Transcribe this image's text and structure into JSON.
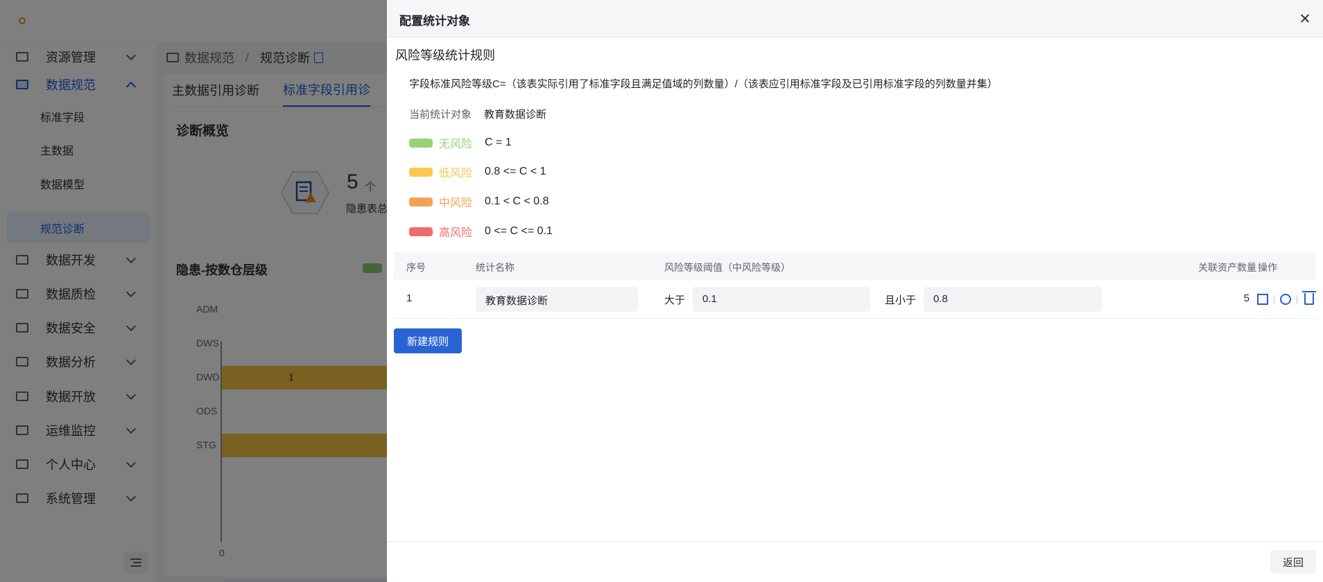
{
  "sidebar": {
    "items": [
      {
        "label": "资源管理",
        "icon": "resource-icon"
      },
      {
        "label": "数据规范",
        "icon": "standard-icon",
        "open": true
      },
      {
        "label": "数据开发",
        "icon": "dev-icon"
      },
      {
        "label": "数据质检",
        "icon": "quality-icon"
      },
      {
        "label": "数据安全",
        "icon": "security-icon"
      },
      {
        "label": "数据分析",
        "icon": "analysis-icon"
      },
      {
        "label": "数据开放",
        "icon": "open-icon"
      },
      {
        "label": "运维监控",
        "icon": "monitor-icon"
      },
      {
        "label": "个人中心",
        "icon": "user-icon"
      },
      {
        "label": "系统管理",
        "icon": "system-icon"
      }
    ],
    "sub_items": [
      "标准字段",
      "主数据",
      "数据模型",
      "规范诊断"
    ]
  },
  "breadcrumb": {
    "parent": "数据规范",
    "current": "规范诊断"
  },
  "tabs": [
    "主数据引用诊断",
    "标准字段引用诊"
  ],
  "overview": {
    "title": "诊断概览",
    "count": "5",
    "unit": "个",
    "label": "隐患表总"
  },
  "chart_section": {
    "title": "隐患-按数仓层级"
  },
  "chart_data": {
    "type": "bar",
    "orientation": "horizontal",
    "categories": [
      "ADM",
      "DWS",
      "DWD",
      "ODS",
      "STG"
    ],
    "values": [
      null,
      null,
      1,
      null,
      null
    ],
    "value_labels": [
      "",
      "",
      "1",
      "",
      ""
    ],
    "x_tick_zero": "0"
  },
  "drawer": {
    "title": "配置统计对象",
    "rule_title": "风险等级统计规则",
    "formula": "字段标准风险等级C=（该表实际引用了标准字段且满足值域的列数量）/（该表应引用标准字段及已引用标准字段的列数量并集）",
    "current_label": "当前统计对象",
    "current_value": "教育数据诊断",
    "levels": [
      {
        "name": "无风险",
        "cond": "C = 1",
        "color": "#95d475"
      },
      {
        "name": "低风险",
        "cond": "0.8 <= C < 1",
        "color": "#f8c84f"
      },
      {
        "name": "中风险",
        "cond": "0.1 < C < 0.8",
        "color": "#f2a254"
      },
      {
        "name": "高风险",
        "cond": "0 <= C <= 0.1",
        "color": "#ef6b6b"
      }
    ],
    "table": {
      "headers": {
        "index": "序号",
        "name": "统计名称",
        "threshold": "风险等级阈值（中风险等级）",
        "assets": "关联资产数量",
        "ops": "操作"
      },
      "rows": [
        {
          "index": "1",
          "name": "教育数据诊断",
          "gt_label": "大于",
          "gt_value": "0.1",
          "lt_label": "且小于",
          "lt_value": "0.8",
          "assets": "5"
        }
      ]
    },
    "new_rule_label": "新建规则",
    "back_label": "返回"
  }
}
